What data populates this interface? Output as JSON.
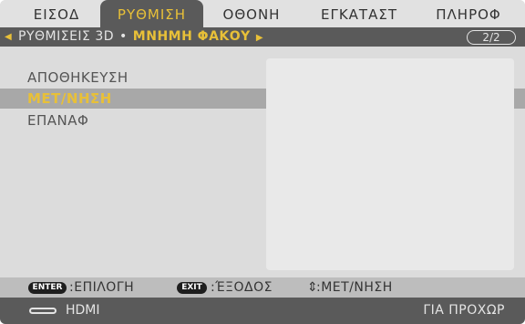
{
  "tabs": [
    {
      "label": "ΕΙΣΟΔ",
      "active": false
    },
    {
      "label": "ΡΥΘΜΙΣΗ",
      "active": true
    },
    {
      "label": "ΟΘΟΝΗ",
      "active": false
    },
    {
      "label": "ΕΓΚΑΤΑΣΤ",
      "active": false
    },
    {
      "label": "ΠΛΗΡΟΦ",
      "active": false
    }
  ],
  "breadcrumb": {
    "parent": "ΡΥΘΜΙΣΕΙΣ 3D",
    "separator": "•",
    "current": "ΜΝΗΜΗ ΦΑΚΟΥ",
    "page_indicator": "2/2"
  },
  "menu_items": [
    {
      "label": "ΑΠΟΘΗΚΕΥΣΗ",
      "selected": false
    },
    {
      "label": "ΜΕΤ/ΝΗΣΗ",
      "selected": true
    },
    {
      "label": "ΕΠΑΝΑΦ",
      "selected": false
    }
  ],
  "help": {
    "enter_key": "ENTER",
    "enter_label": ":ΕΠΙΛΟΓΗ",
    "exit_key": "EXIT",
    "exit_label": ":ΈΞΟΔΟΣ",
    "move_icon": "⇕",
    "move_label": ":ΜΕΤ/ΝΗΣΗ"
  },
  "status": {
    "source_icon": "hdmi-connector-icon",
    "source_label": "HDMI",
    "right_label": "ΓΙΑ ΠΡΟΧΩΡ"
  },
  "colors": {
    "accent": "#e8c038",
    "bar_dark": "#5a5a5a",
    "background": "#dcdcdc",
    "selection": "#a8a8a8"
  }
}
